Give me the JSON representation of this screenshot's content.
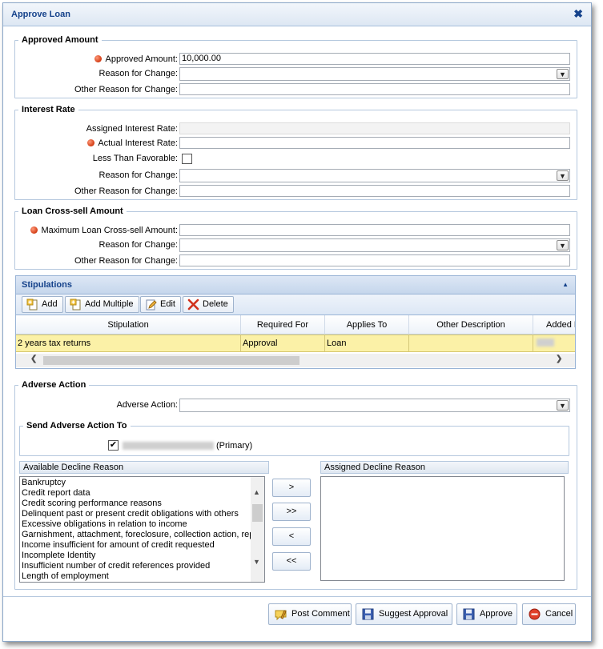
{
  "dialog": {
    "title": "Approve Loan",
    "close_symbol": "✖"
  },
  "approved_amount": {
    "legend": "Approved Amount",
    "amount_label": "Approved Amount:",
    "amount_value": "10,000.00",
    "reason_label": "Reason for Change:",
    "other_reason_label": "Other Reason for Change:"
  },
  "interest_rate": {
    "legend": "Interest Rate",
    "assigned_label": "Assigned Interest Rate:",
    "actual_label": "Actual Interest Rate:",
    "less_favorable_label": "Less Than Favorable:",
    "reason_label": "Reason for Change:",
    "other_reason_label": "Other Reason for Change:"
  },
  "cross_sell": {
    "legend": "Loan Cross-sell Amount",
    "max_label": "Maximum Loan Cross-sell Amount:",
    "reason_label": "Reason for Change:",
    "other_reason_label": "Other Reason for Change:"
  },
  "stipulations": {
    "title": "Stipulations",
    "toolbar": {
      "add": "Add",
      "add_multiple": "Add Multiple",
      "edit": "Edit",
      "delete": "Delete"
    },
    "columns": [
      "Stipulation",
      "Required For",
      "Applies To",
      "Other Description",
      "Added By"
    ],
    "rows": [
      {
        "stipulation": "2 years tax returns",
        "required_for": "Approval",
        "applies_to": "Loan",
        "other_description": ""
      }
    ]
  },
  "adverse_action": {
    "legend": "Adverse Action",
    "action_label": "Adverse Action:",
    "send_to_legend": "Send Adverse Action To",
    "recipient_suffix": "(Primary)",
    "available_header": "Available Decline Reason",
    "assigned_header": "Assigned Decline Reason",
    "available_reasons": [
      "Bankruptcy",
      "Credit report data",
      "Credit scoring performance reasons",
      "Delinquent past or present credit obligations with others",
      "Excessive obligations in relation to income",
      "Garnishment, attachment, foreclosure, collection action, repossession",
      "Income insufficient for amount of credit requested",
      "Incomplete Identity",
      "Insufficient number of credit references provided",
      "Length of employment"
    ],
    "move_buttons": {
      "add_one": ">",
      "add_all": ">>",
      "remove_one": "<",
      "remove_all": "<<"
    }
  },
  "footer": {
    "post_comment": "Post Comment",
    "suggest_approval": "Suggest Approval",
    "approve": "Approve",
    "cancel": "Cancel"
  },
  "colors": {
    "title": "#15428b",
    "required": "#d23a12",
    "row_highlight": "#fbf1a7"
  }
}
